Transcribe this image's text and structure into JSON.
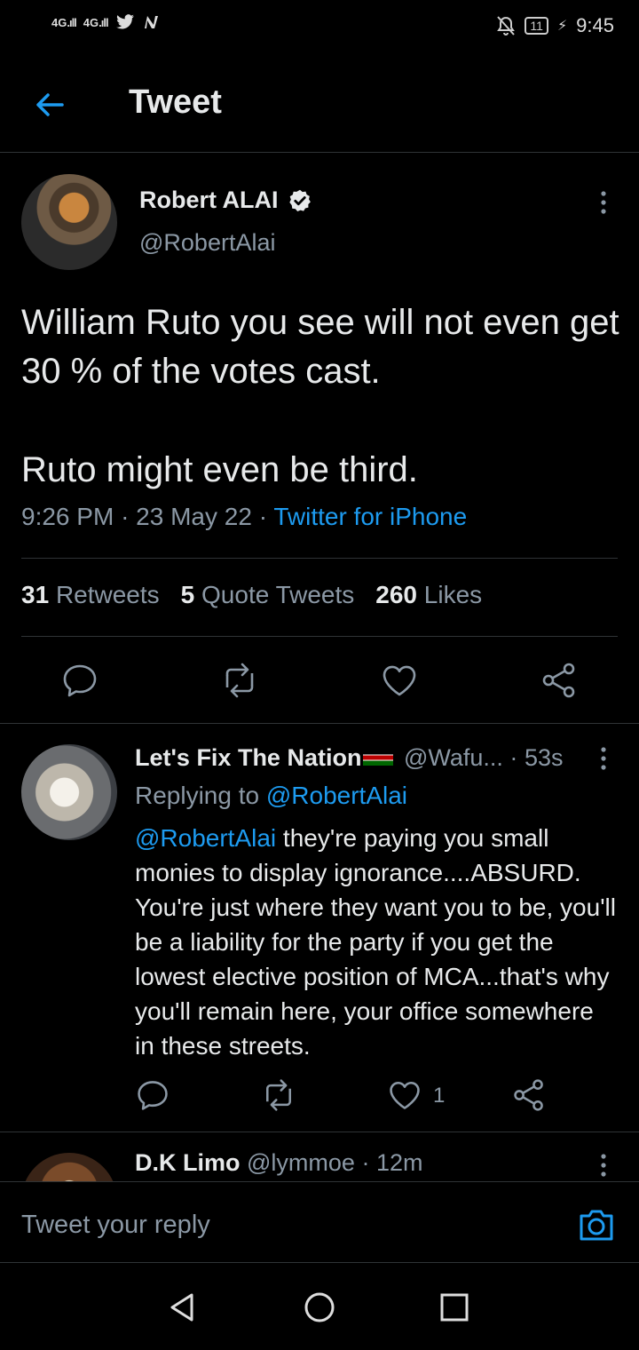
{
  "status_bar": {
    "signal1": "4G",
    "signal2": "4G",
    "battery": "11",
    "time": "9:45"
  },
  "header": {
    "title": "Tweet"
  },
  "tweet": {
    "author": "Robert ALAI",
    "handle": "@RobertAlai",
    "text_line1": "William Ruto you see will not even get 30 % of the votes cast.",
    "text_line2": "Ruto might even be third.",
    "time": "9:26 PM",
    "date": "23 May 22",
    "source": "Twitter for iPhone",
    "retweets": "31",
    "retweets_label": "Retweets",
    "quotes": "5",
    "quotes_label": "Quote Tweets",
    "likes": "260",
    "likes_label": "Likes"
  },
  "reply": {
    "author": "Let's Fix The Nation",
    "handle": "@Wafu...",
    "time": "53s",
    "replying_label": "Replying to",
    "replying_to": "@RobertAlai",
    "mention": "@RobertAlai",
    "text": " they're paying you small monies to display ignorance....ABSURD. You're just where they want you to be, you'll be a liability for the party if you get the lowest elective position of MCA...that's why you'll remain here, your office somewhere in these streets.",
    "likes": "1"
  },
  "reply2": {
    "author": "D.K Limo",
    "handle": "@lymmoe",
    "time": "12m"
  },
  "compose": {
    "placeholder": "Tweet your reply"
  },
  "colors": {
    "accent": "#1d9bf0",
    "background": "#000000",
    "muted": "#8b98a5"
  }
}
